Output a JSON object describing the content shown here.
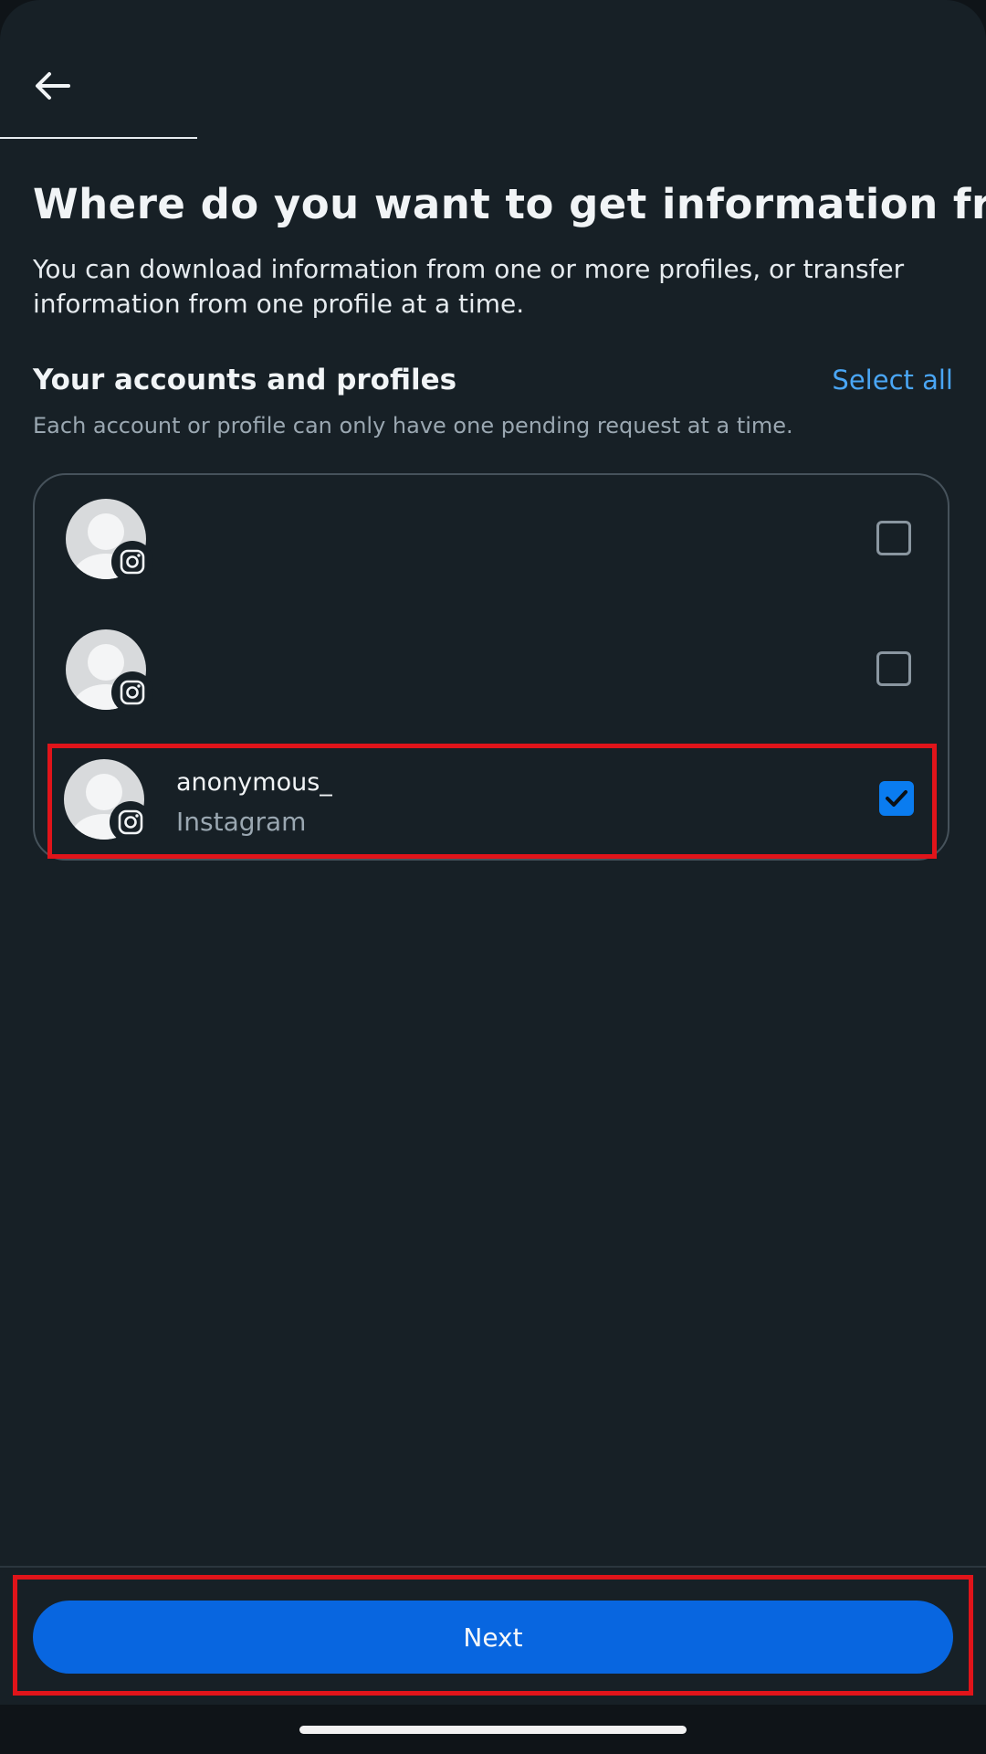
{
  "header": {
    "back_icon": "arrow-left-icon"
  },
  "page": {
    "title": "Where do you want to get information from?",
    "subtitle": "You can download information from one or more profiles, or transfer information from one profile at a time."
  },
  "accounts_section": {
    "title": "Your accounts and profiles",
    "select_all_label": "Select all",
    "hint": "Each account or profile can only have one pending request at a time.",
    "items": [
      {
        "name": "",
        "platform": "",
        "checked": false,
        "badge_icon": "instagram-icon"
      },
      {
        "name": "",
        "platform": "",
        "checked": false,
        "badge_icon": "instagram-icon"
      },
      {
        "name": "anonymous_",
        "platform": "Instagram",
        "checked": true,
        "badge_icon": "instagram-icon"
      }
    ]
  },
  "footer": {
    "next_label": "Next"
  },
  "colors": {
    "background": "#172026",
    "accent": "#0866e0",
    "link": "#4aa6f5",
    "checkbox_checked": "#0a7cf0",
    "highlight": "#e0141a"
  }
}
